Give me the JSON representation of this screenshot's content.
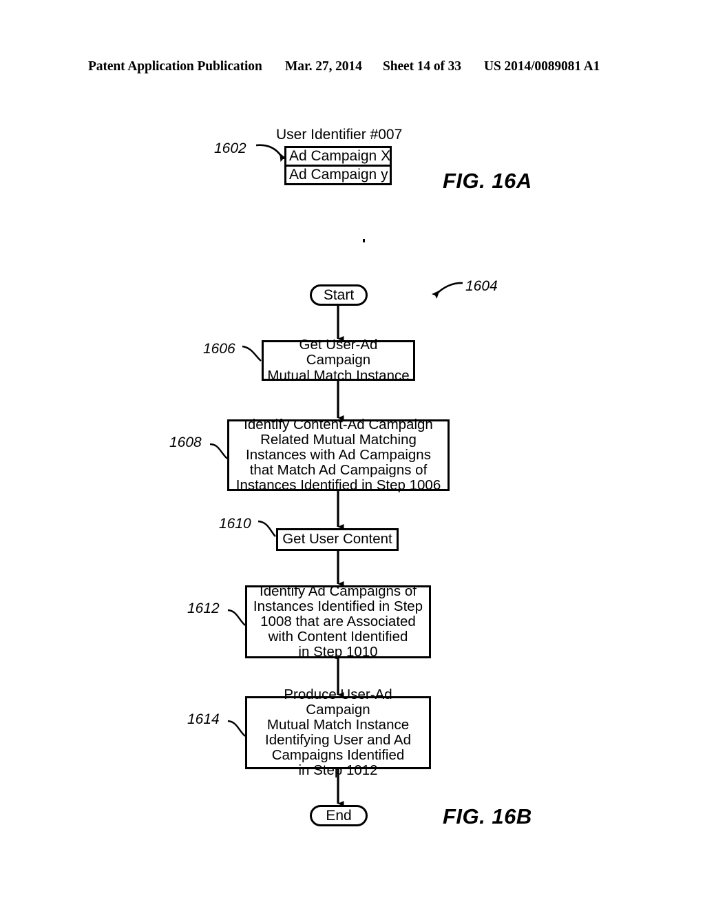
{
  "header": {
    "publication": "Patent Application Publication",
    "date": "Mar. 27, 2014",
    "sheet": "Sheet 14 of 33",
    "patent_number": "US 2014/0089081 A1"
  },
  "figures": [
    {
      "caption": "FIG. 16A",
      "reference": "1602",
      "title": "User Identifier #007",
      "rows": [
        "Ad Campaign X",
        "Ad Campaign y"
      ]
    },
    {
      "caption": "FIG. 16B",
      "reference": "1604",
      "start_label": "Start",
      "end_label": "End",
      "steps": [
        {
          "ref": "1606",
          "lines": [
            "Get User-Ad Campaign",
            "Mutual Match Instance"
          ]
        },
        {
          "ref": "1608",
          "lines": [
            "Identify Content-Ad Campaign",
            "Related Mutual Matching",
            "Instances with Ad Campaigns",
            "that Match Ad Campaigns of",
            "Instances Identified in Step 1006"
          ]
        },
        {
          "ref": "1610",
          "lines": [
            "Get User Content"
          ]
        },
        {
          "ref": "1612",
          "lines": [
            "Identify Ad Campaigns of",
            "Instances Identified in Step",
            "1008 that are Associated",
            "with Content Identified",
            "in Step 1010"
          ]
        },
        {
          "ref": "1614",
          "lines": [
            "Produce User-Ad Campaign",
            "Mutual Match Instance",
            "Identifying User and Ad",
            "Campaigns Identified",
            "in Step 1012"
          ]
        }
      ]
    }
  ],
  "colors": {
    "ink": "#000000",
    "paper": "#ffffff"
  }
}
